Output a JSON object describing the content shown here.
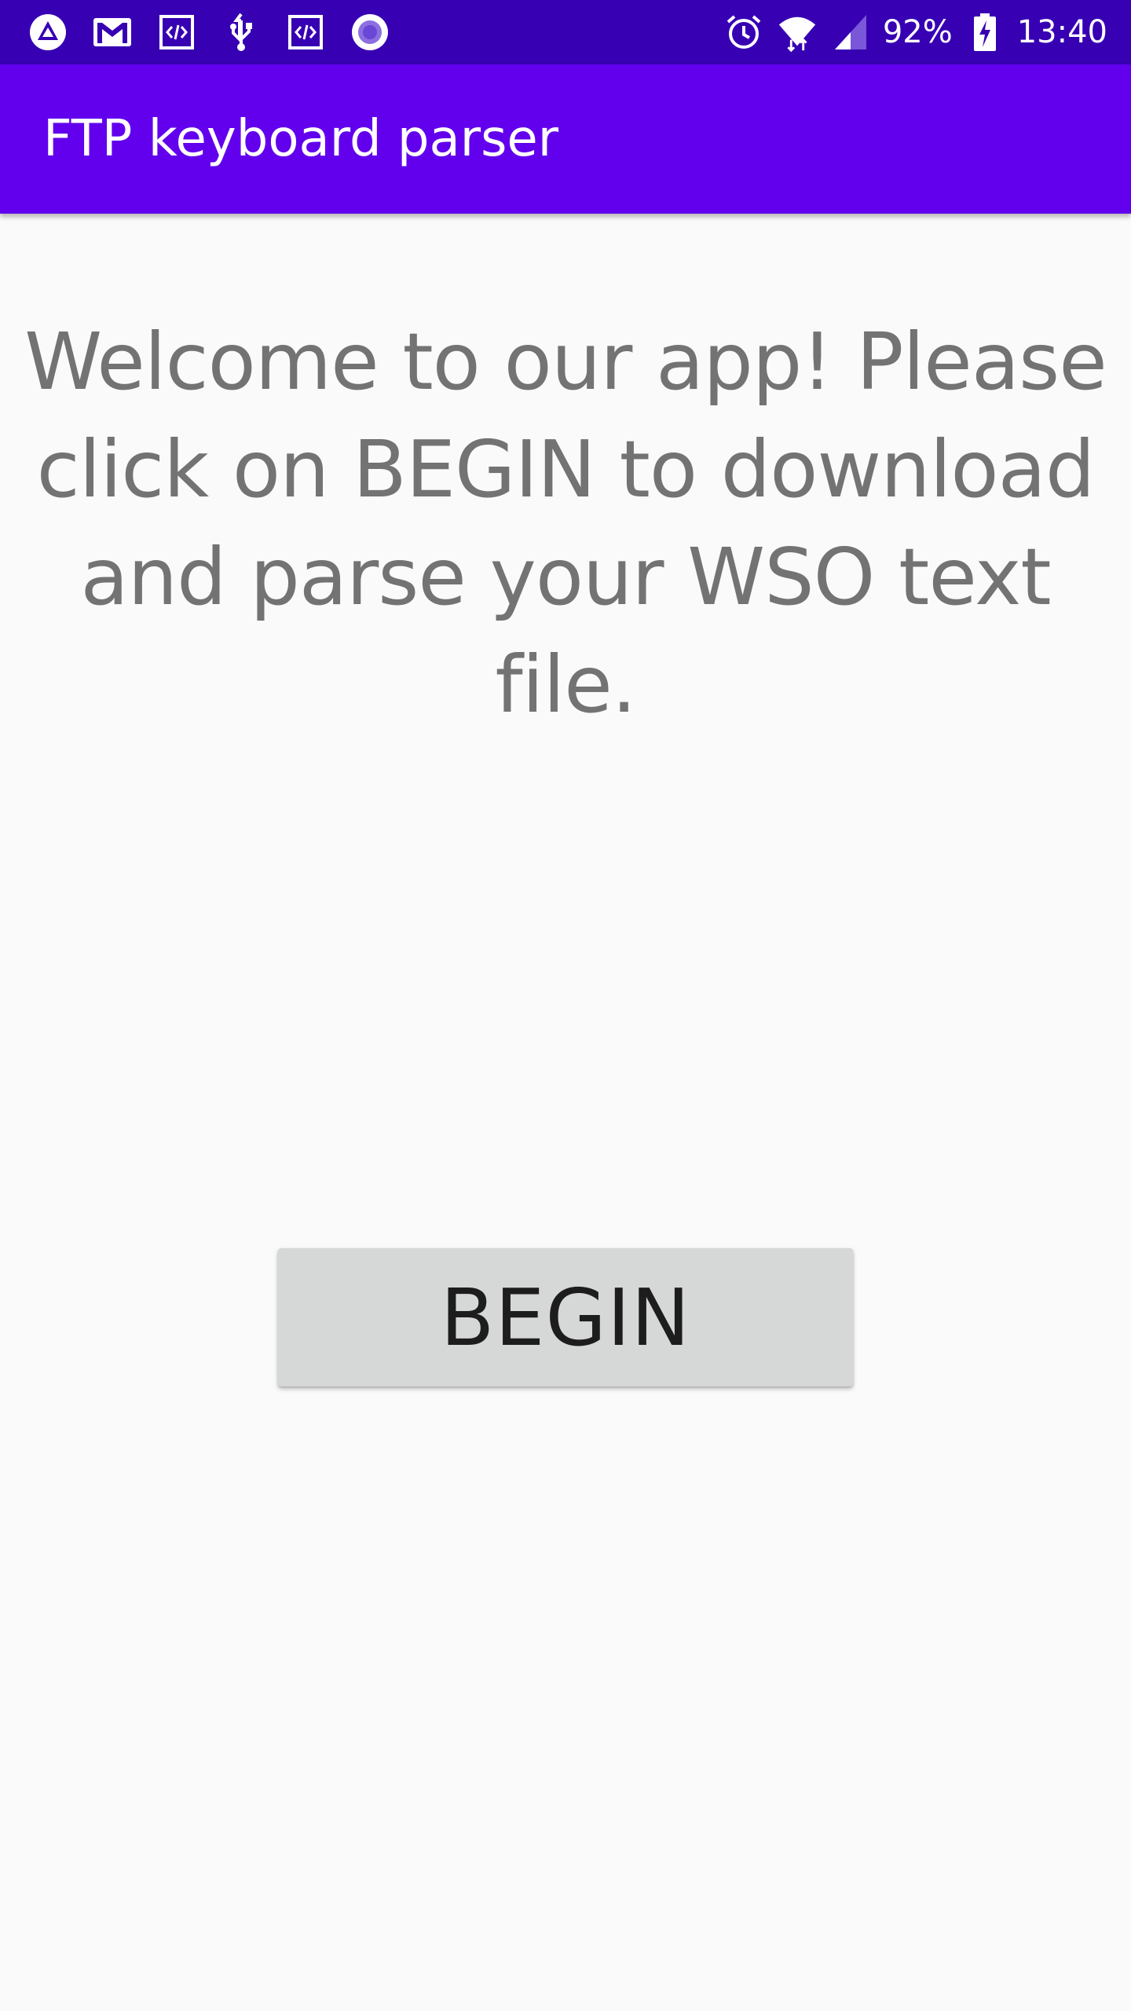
{
  "status_bar": {
    "left_icons": [
      "warning-triangle-icon",
      "gmail-icon",
      "code-icon",
      "usb-icon",
      "code-icon",
      "circle-record-icon"
    ],
    "right_icons": [
      "alarm-icon",
      "wifi-icon",
      "signal-icon",
      "battery-charging-icon"
    ],
    "battery_percent": "92%",
    "time": "13:40",
    "color": "#3700b3"
  },
  "app_bar": {
    "title": "FTP keyboard parser",
    "color": "#6200ee"
  },
  "main": {
    "welcome_text": "Welcome to our app! Please click on BEGIN to download and parse your WSO text file.",
    "begin_label": "BEGIN"
  }
}
